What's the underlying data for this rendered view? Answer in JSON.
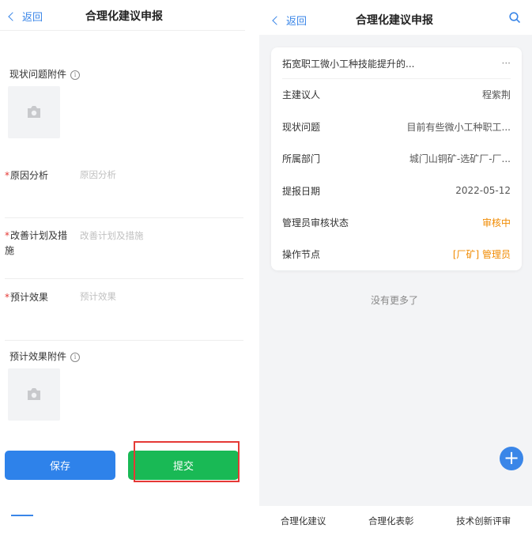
{
  "left": {
    "back_label": "返回",
    "title": "合理化建议申报",
    "attachment_label": "现状问题附件",
    "cause_label": "原因分析",
    "cause_placeholder": "原因分析",
    "plan_label": "改善计划及措施",
    "plan_placeholder": "改善计划及措施",
    "effect_label": "预计效果",
    "effect_placeholder": "预计效果",
    "effect_attachment_label": "预计效果附件",
    "save_label": "保存",
    "submit_label": "提交"
  },
  "right": {
    "back_label": "返回",
    "title": "合理化建议申报",
    "card": {
      "title": "拓宽职工微小工种技能提升的...",
      "more": "···",
      "rows": [
        {
          "key": "主建议人",
          "value": "程紫荆"
        },
        {
          "key": "现状问题",
          "value": "目前有些微小工种职工..."
        },
        {
          "key": "所属部门",
          "value": "城门山铜矿-选矿厂-厂..."
        },
        {
          "key": "提报日期",
          "value": "2022-05-12"
        },
        {
          "key": "管理员审核状态",
          "value": "审核中"
        },
        {
          "key": "操作节点",
          "value": "[厂矿] 管理员"
        }
      ]
    },
    "no_more": "没有更多了",
    "fab": "+",
    "tabs": [
      "合理化建议",
      "合理化表彰",
      "技术创新评审"
    ]
  },
  "colors": {
    "accent": "#3a86e8",
    "submit": "#19b955",
    "status": "#f08a00",
    "required": "#e53935"
  }
}
